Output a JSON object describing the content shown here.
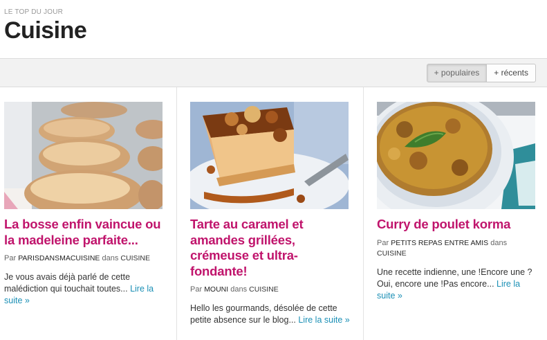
{
  "header": {
    "eyebrow": "LE TOP DU JOUR",
    "title": "Cuisine"
  },
  "filters": {
    "popular_label": "+ populaires",
    "recent_label": "+ récents"
  },
  "byline_labels": {
    "by": "Par",
    "in": "dans"
  },
  "colors": {
    "title_accent": "#c0146c",
    "link": "#1a8fb5"
  },
  "cards": [
    {
      "title": "La bosse enfin vaincue ou la madeleine parfaite...",
      "author": "PARISDANSMACUISINE",
      "category": "CUISINE",
      "excerpt": "Je vous avais déjà parlé de cette malédiction qui touchait toutes... ",
      "read_more": "Lire la suite »"
    },
    {
      "title": "Tarte au caramel et amandes grillées, crémeuse et ultra-fondante!",
      "author": "MOUNI",
      "category": "CUISINE",
      "excerpt": "Hello les gourmands, désolée de cette petite absence sur le blog... ",
      "read_more": "Lire la suite »"
    },
    {
      "title": "Curry de poulet korma",
      "author": "PETITS REPAS ENTRE AMIS",
      "category": "CUISINE",
      "excerpt": "Une recette indienne, une !Encore une ? Oui, encore une !Pas encore... ",
      "read_more": "Lire la suite »"
    }
  ]
}
